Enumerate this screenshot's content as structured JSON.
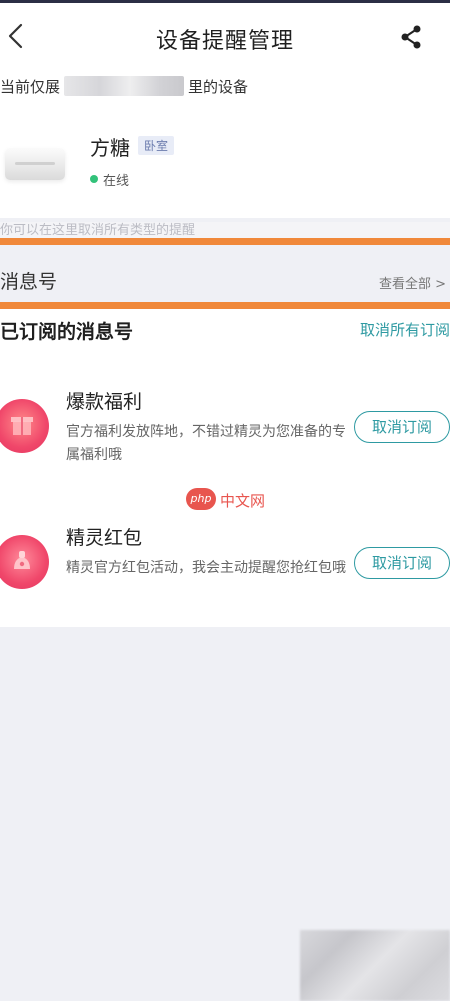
{
  "header": {
    "title": "设备提醒管理",
    "back_icon": "chevron-left-icon",
    "share_icon": "share-icon"
  },
  "device_section": {
    "current_prefix": "当前仅展",
    "current_suffix": "里的设备",
    "device": {
      "name": "方糖",
      "room": "卧室",
      "status": "在线",
      "status_color": "#32c27a"
    },
    "tip": "你可以在这里取消所有类型的提醒"
  },
  "message_section": {
    "label": "消息号",
    "view_all": "查看全部 >"
  },
  "subscribed": {
    "title": "已订阅的消息号",
    "cancel_all": "取消所有订阅",
    "items": [
      {
        "name": "爆款福利",
        "desc": "官方福利发放阵地，不错过精灵为您准备的专属福利哦",
        "button": "取消订阅",
        "icon": "gift-icon"
      },
      {
        "name": "精灵红包",
        "desc": "精灵官方红包活动，我会主动提醒您抢红包哦",
        "button": "取消订阅",
        "icon": "red-packet-icon"
      }
    ]
  },
  "watermark": {
    "badge": "php",
    "text": "中文网"
  },
  "colors": {
    "accent": "#2e9aa2",
    "highlight": "#f0883a",
    "background": "#eff0f5"
  }
}
